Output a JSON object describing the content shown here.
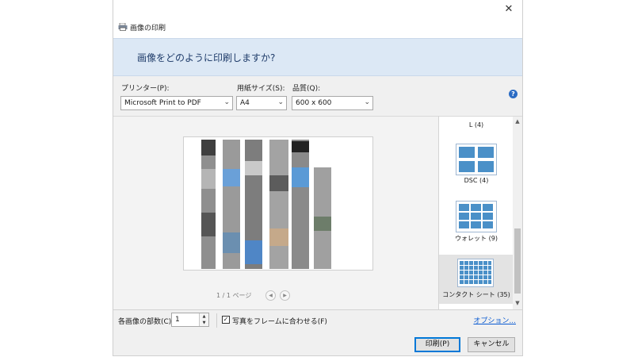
{
  "window": {
    "title": "画像の印刷",
    "close_glyph": "✕",
    "banner": "画像をどのように印刷しますか?"
  },
  "settings": {
    "printer_label": "プリンター(P):",
    "printer_value": "Microsoft Print to PDF",
    "paper_label": "用紙サイズ(S):",
    "paper_value": "A4",
    "quality_label": "品質(Q):",
    "quality_value": "600 x 600",
    "help_glyph": "?"
  },
  "preview": {
    "page_indicator": "1 / 1 ページ"
  },
  "layouts": {
    "items": [
      {
        "label": "L (4)"
      },
      {
        "label": "DSC (4)"
      },
      {
        "label": "ウォレット (9)"
      },
      {
        "label": "コンタクト シート (35)"
      }
    ],
    "selected_index": 3
  },
  "options": {
    "copies_label": "各画像の部数(C):",
    "copies_value": "1",
    "fit_label": "写真をフレームに合わせる(F)",
    "fit_checked": true,
    "options_link": "オプション..."
  },
  "buttons": {
    "print_label": "印刷(P)",
    "cancel_label": "キャンセル"
  },
  "colors": {
    "banner_bg": "#dce8f5",
    "accent": "#0078d7",
    "link": "#0b5bd1"
  },
  "icons": {
    "dropdown": "chevron-down-icon",
    "help": "help-icon",
    "close": "close-icon",
    "check": "checkmark-icon"
  }
}
